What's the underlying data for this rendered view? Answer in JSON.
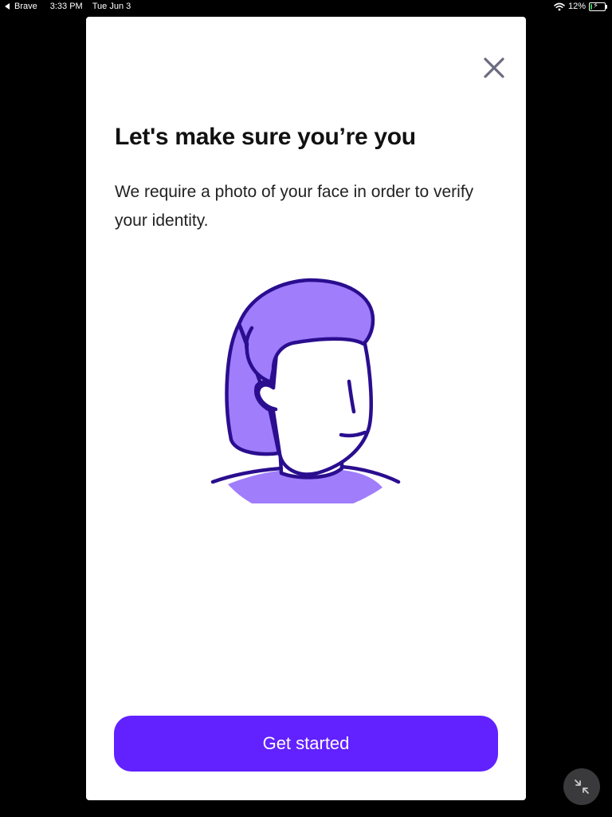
{
  "status_bar": {
    "back_app": "Brave",
    "time": "3:33 PM",
    "date": "Tue Jun 3",
    "battery_percent": "12%",
    "battery_level": 0.12,
    "charging": true,
    "icons": [
      "back-arrow-icon",
      "wifi-icon",
      "battery-icon",
      "charging-bolt-icon"
    ]
  },
  "modal": {
    "close_icon": "close-icon",
    "title": "Let's make sure you’re you",
    "description": "We require a photo of your face in order to verify your identity.",
    "illustration": "face-avatar-illustration",
    "cta_label": "Get started"
  },
  "floating": {
    "minimize_icon": "minimize-arrows-icon"
  },
  "colors": {
    "accent": "#6221ff",
    "illustration_fill": "#a07dfb",
    "illustration_stroke": "#2a0e8f",
    "close_icon": "#6b6b80",
    "background": "#000000"
  }
}
